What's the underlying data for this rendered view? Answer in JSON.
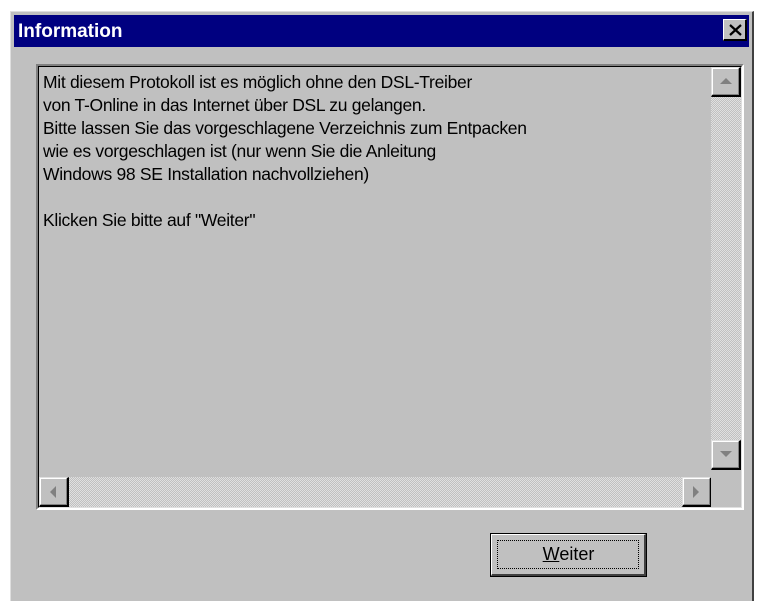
{
  "window": {
    "title": "Information",
    "close_symbol": "×"
  },
  "message": {
    "text": "Mit diesem Protokoll ist es möglich ohne den DSL-Treiber\nvon T-Online in das Internet über DSL zu gelangen.\nBitte lassen Sie das vorgeschlagene Verzeichnis zum Entpacken\nwie es vorgeschlagen ist (nur wenn Sie die Anleitung\nWindows 98 SE Installation nachvollziehen)\n\nKlicken Sie bitte auf \"Weiter\""
  },
  "buttons": {
    "next_accel": "W",
    "next_rest": "eiter"
  },
  "icons": {
    "close": "close-icon",
    "scroll_up": "arrow-up-icon",
    "scroll_down": "arrow-down-icon",
    "scroll_left": "arrow-left-icon",
    "scroll_right": "arrow-right-icon"
  },
  "colors": {
    "titlebar": "#000080",
    "face": "#c0c0c0",
    "title_text": "#ffffff"
  }
}
